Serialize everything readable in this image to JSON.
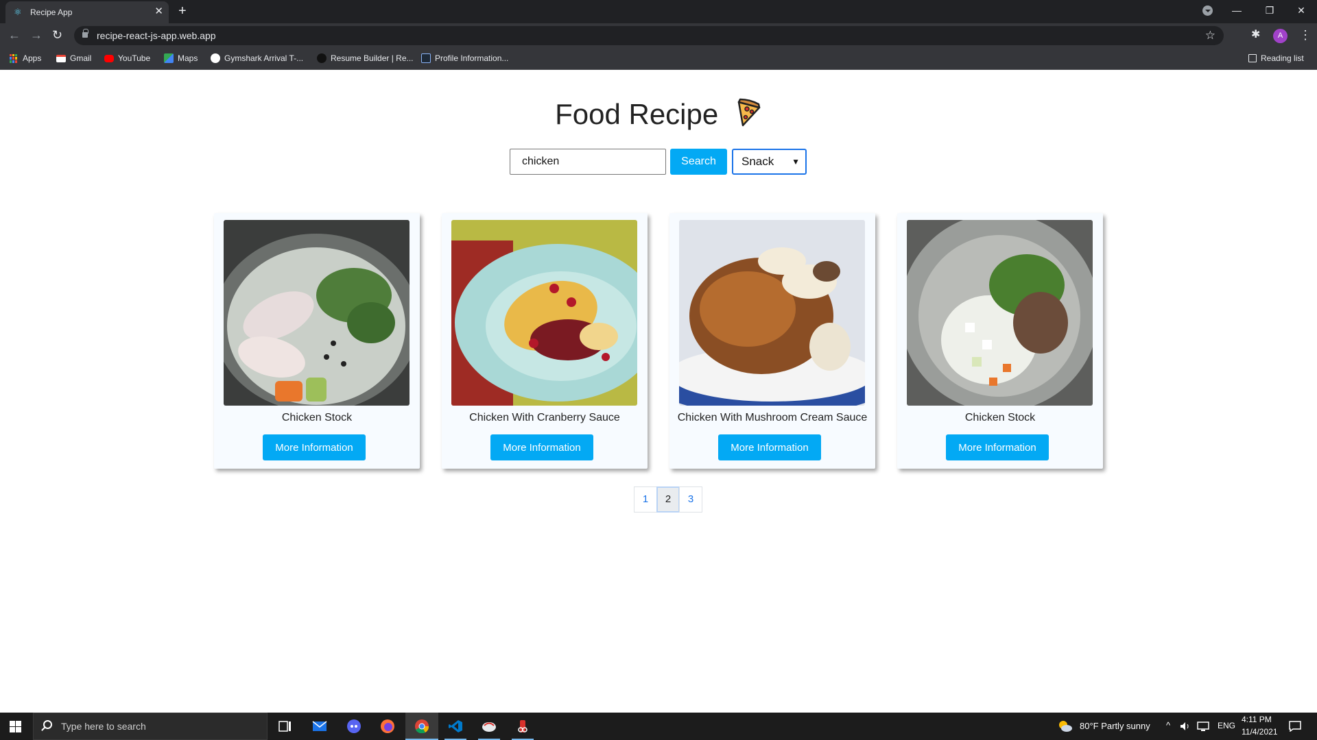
{
  "browser": {
    "tab_title": "Recipe App",
    "tab_close": "✕",
    "new_tab": "+",
    "url": "recipe-react-js-app.web.app",
    "avatar_letter": "A",
    "win_minimize": "—",
    "win_restore": "❐",
    "win_close": "✕",
    "back": "←",
    "forward": "→",
    "reload": "↻",
    "star": "☆",
    "extensions": "✱",
    "menu": "⋮",
    "bookmarks": [
      {
        "label": "Apps",
        "icon": "apps-grid-icon",
        "color": "#e8453c"
      },
      {
        "label": "Gmail",
        "icon": "gmail-icon",
        "color": "#ea4335"
      },
      {
        "label": "YouTube",
        "icon": "youtube-icon",
        "color": "#ff0000"
      },
      {
        "label": "Maps",
        "icon": "maps-icon",
        "color": "#34a853"
      },
      {
        "label": "Gymshark Arrival T-...",
        "icon": "gymshark-icon",
        "color": "#ffffff"
      },
      {
        "label": "Resume Builder | Re...",
        "icon": "resume-icon",
        "color": "#111111"
      },
      {
        "label": "Profile Information...",
        "icon": "profile-icon",
        "color": "#1e2a38"
      }
    ],
    "reading_list": "Reading list"
  },
  "app": {
    "title": "Food Recipe",
    "search": {
      "value": "chicken",
      "button": "Search"
    },
    "filter": {
      "selected": "Snack",
      "arrow": "⌄"
    },
    "accent_color": "#03a9f4",
    "recipes": [
      {
        "title": "Chicken Stock",
        "button": "More Information"
      },
      {
        "title": "Chicken With Cranberry Sauce",
        "button": "More Information"
      },
      {
        "title": "Chicken With Mushroom Cream Sauce",
        "button": "More Information"
      },
      {
        "title": "Chicken Stock",
        "button": "More Information"
      }
    ],
    "pagination": {
      "pages": [
        "1",
        "2",
        "3"
      ],
      "current": "2"
    }
  },
  "taskbar": {
    "search_placeholder": "Type here to search",
    "weather": "80°F  Partly sunny",
    "language": "ENG",
    "time": "4:11 PM",
    "date": "11/4/2021",
    "tray_chevron": "^"
  }
}
